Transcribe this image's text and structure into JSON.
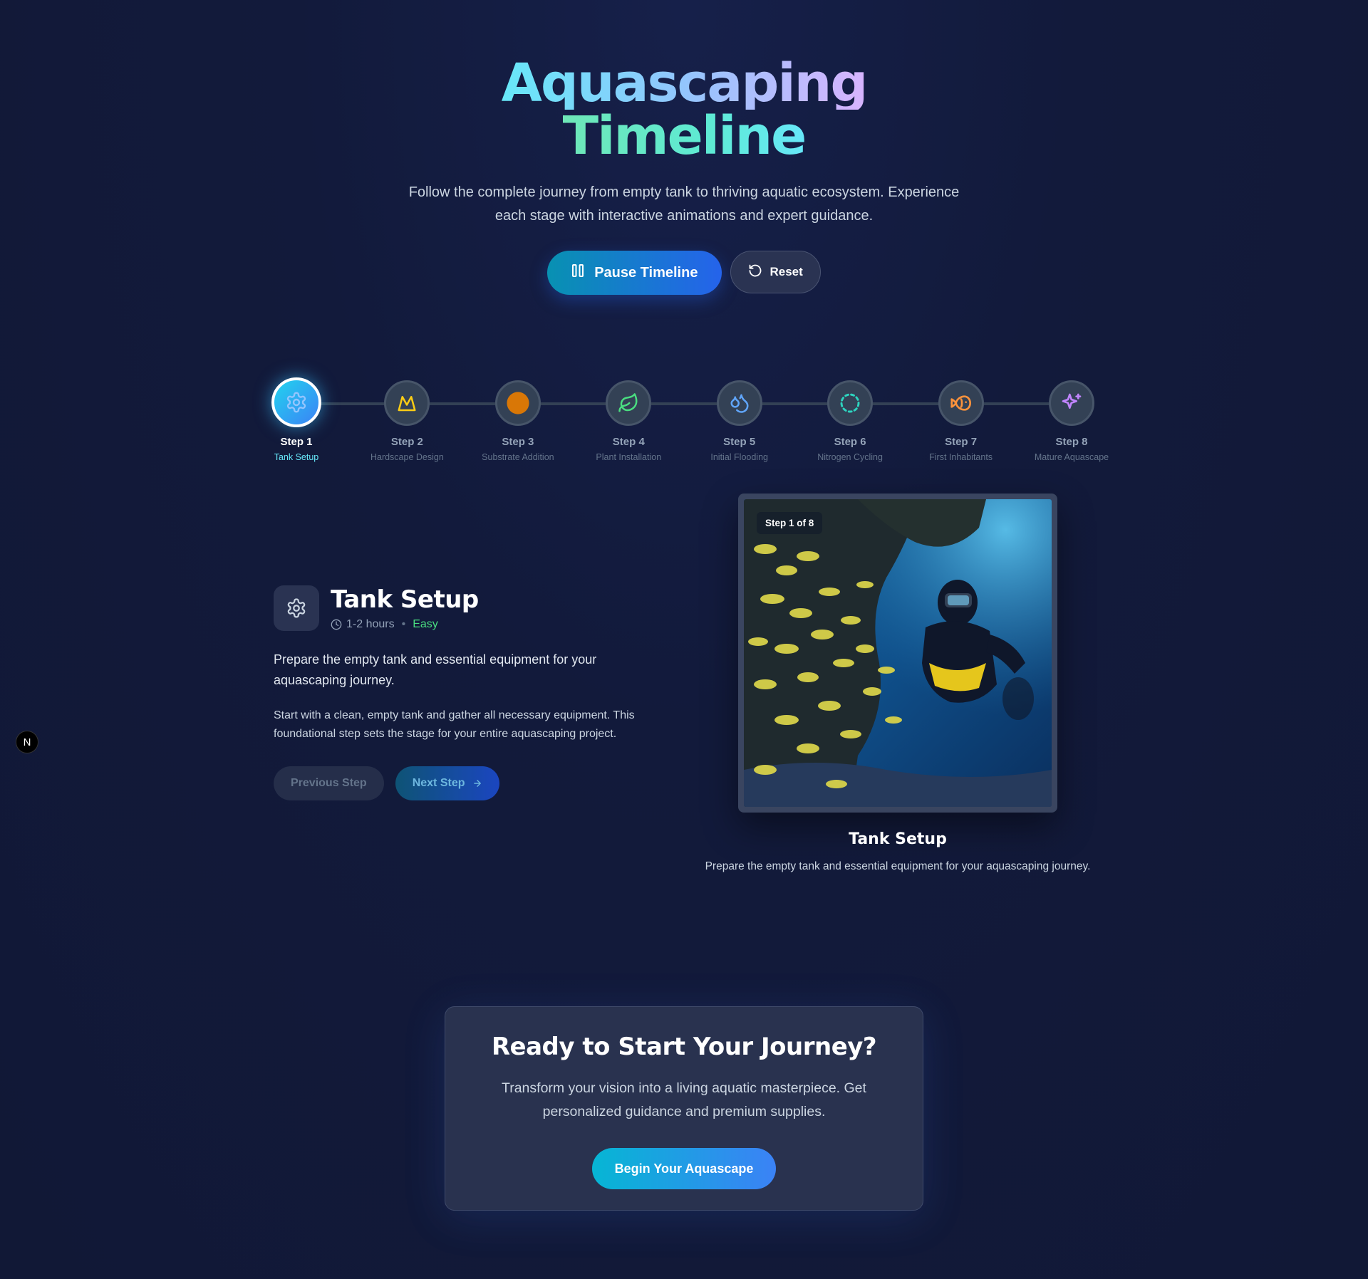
{
  "hero": {
    "title_line1": "Aquascaping",
    "title_line2": "Timeline",
    "subtitle": "Follow the complete journey from empty tank to thriving aquatic ecosystem. Experience each stage with interactive animations and expert guidance.",
    "pause_label": "Pause Timeline",
    "reset_label": "Reset"
  },
  "timeline": {
    "steps": [
      {
        "num": "Step 1",
        "name": "Tank Setup",
        "icon": "gear-icon",
        "color": "#60a5fa",
        "active": true
      },
      {
        "num": "Step 2",
        "name": "Hardscape Design",
        "icon": "mountain-icon",
        "color": "#facc15"
      },
      {
        "num": "Step 3",
        "name": "Substrate Addition",
        "icon": "circle-icon",
        "color": "#d97706"
      },
      {
        "num": "Step 4",
        "name": "Plant Installation",
        "icon": "leaf-icon",
        "color": "#4ade80"
      },
      {
        "num": "Step 5",
        "name": "Initial Flooding",
        "icon": "droplets-icon",
        "color": "#60a5fa"
      },
      {
        "num": "Step 6",
        "name": "Nitrogen Cycling",
        "icon": "cycle-icon",
        "color": "#2dd4bf"
      },
      {
        "num": "Step 7",
        "name": "First Inhabitants",
        "icon": "fish-icon",
        "color": "#fb923c"
      },
      {
        "num": "Step 8",
        "name": "Mature Aquascape",
        "icon": "sparkles-icon",
        "color": "#c084fc"
      }
    ]
  },
  "detail": {
    "title": "Tank Setup",
    "duration": "1-2 hours",
    "difficulty": "Easy",
    "description": "Prepare the empty tank and essential equipment for your aquascaping journey.",
    "long_description": "Start with a clean, empty tank and gather all necessary equipment. This foundational step sets the stage for your entire aquascaping project.",
    "prev_label": "Previous Step",
    "next_label": "Next Step"
  },
  "image": {
    "badge": "Step 1 of 8",
    "caption_title": "Tank Setup",
    "caption_desc": "Prepare the empty tank and essential equipment for your aquascaping journey."
  },
  "cta": {
    "title": "Ready to Start Your Journey?",
    "text": "Transform your vision into a living aquatic masterpiece. Get personalized guidance and premium supplies.",
    "button": "Begin Your Aquascape"
  },
  "dev_badge": "N"
}
